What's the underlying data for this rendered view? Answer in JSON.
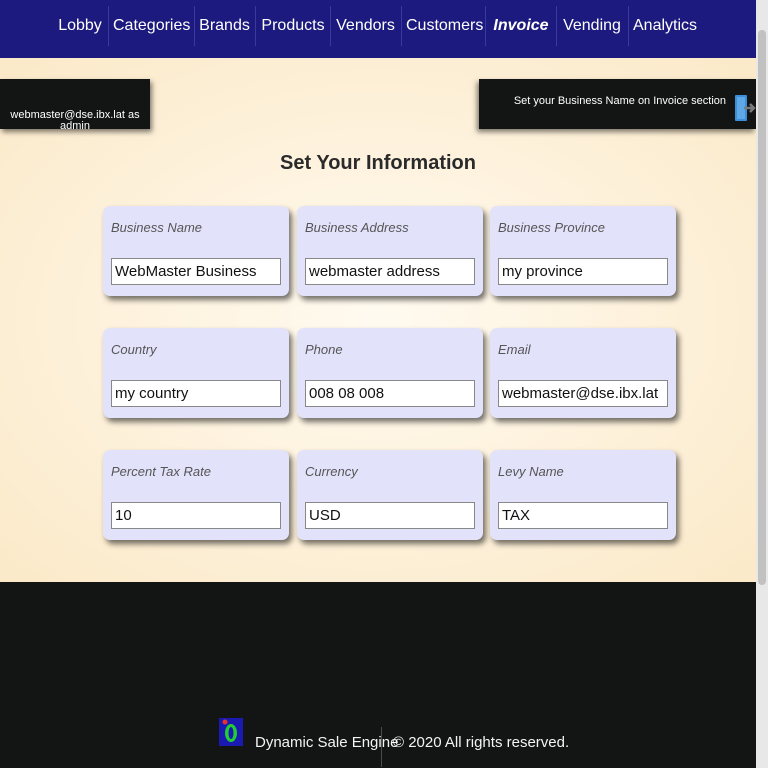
{
  "nav": {
    "items": [
      {
        "label": "Lobby"
      },
      {
        "label": "Categories"
      },
      {
        "label": "Brands"
      },
      {
        "label": "Products"
      },
      {
        "label": "Vendors"
      },
      {
        "label": "Customers"
      },
      {
        "label": "Invoice",
        "active": true
      },
      {
        "label": "Vending"
      },
      {
        "label": "Analytics"
      }
    ]
  },
  "user": {
    "text": "webmaster@dse.ibx.lat as admin"
  },
  "help": {
    "text": "Set your Business Name on Invoice section",
    "icon": "exit-door-icon",
    "icon_color": "#3a8fd8"
  },
  "form": {
    "heading": "Set Your Information",
    "fields": [
      {
        "label": "Business Name",
        "value": "WebMaster Business"
      },
      {
        "label": "Business Address",
        "value": "webmaster address"
      },
      {
        "label": "Business Province",
        "value": "my province"
      },
      {
        "label": "Country",
        "value": "my country"
      },
      {
        "label": "Phone",
        "value": "008 08 008"
      },
      {
        "label": "Email",
        "value": "webmaster@dse.ibx.lat"
      },
      {
        "label": "Percent Tax Rate",
        "value": "10"
      },
      {
        "label": "Currency",
        "value": "USD"
      },
      {
        "label": "Levy Name",
        "value": "TAX"
      }
    ]
  },
  "footer": {
    "engine": "Dynamic Sale Engine",
    "copyright": "© 2020 All rights reserved."
  },
  "colors": {
    "nav_bg": "#1c1a7e",
    "card_bg": "#e3e2fb",
    "dark_bg": "#121514",
    "page_bg": "#fdf1dc"
  }
}
